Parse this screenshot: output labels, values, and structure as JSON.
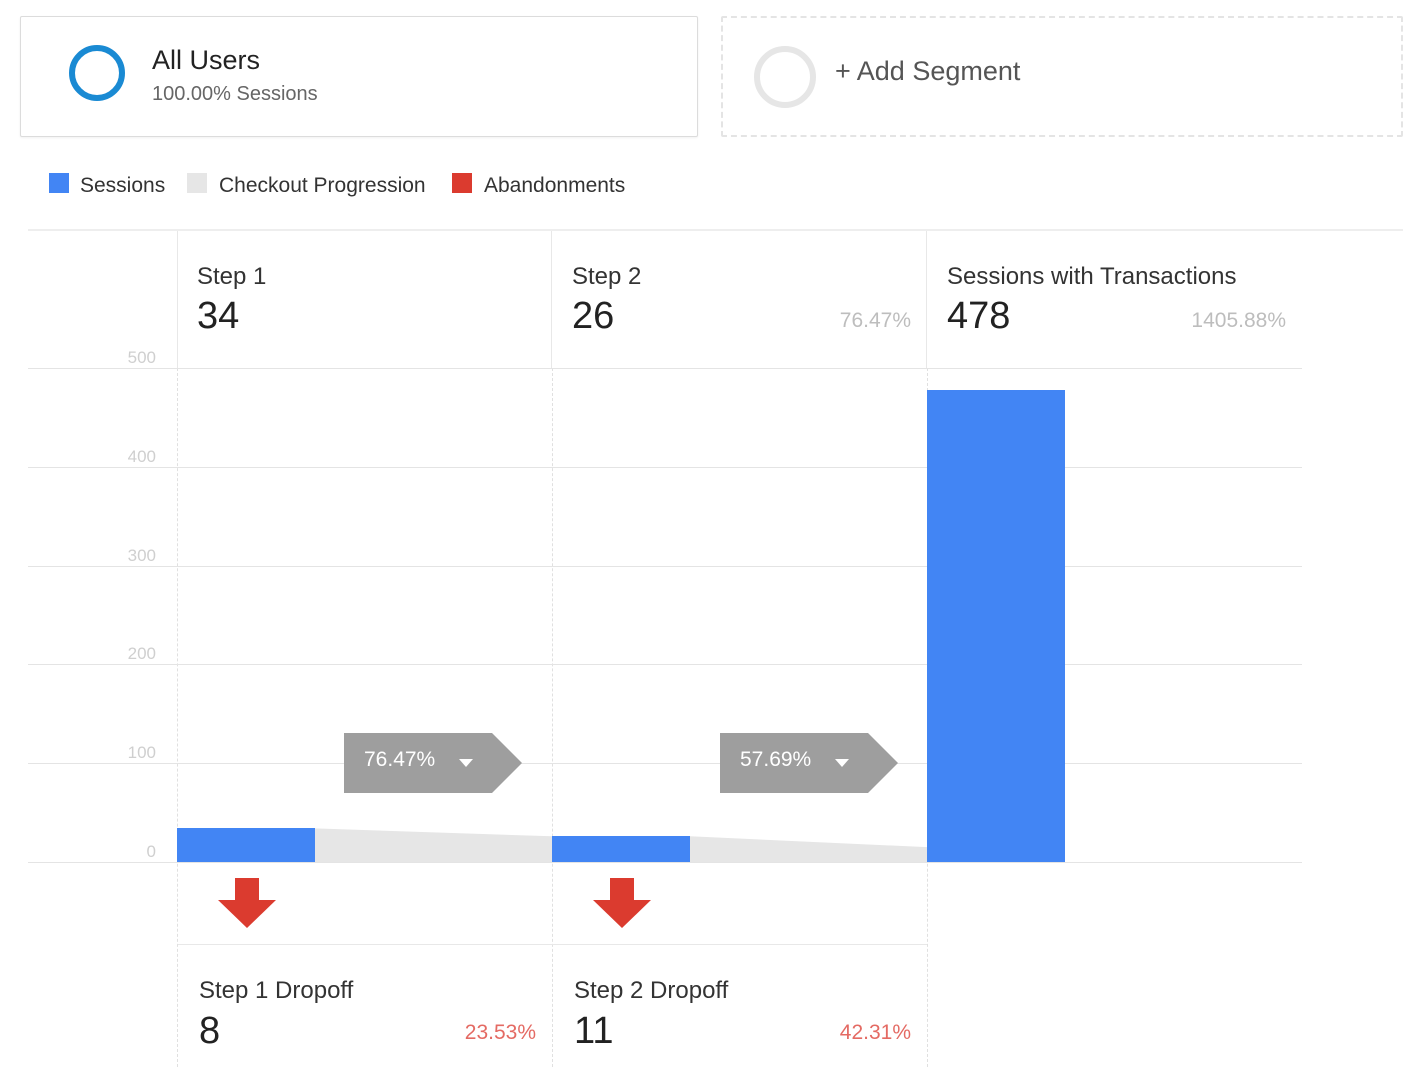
{
  "segments": {
    "active": {
      "title": "All Users",
      "subtitle": "100.00% Sessions",
      "ring_color": "#1a8ad3"
    },
    "add_label": "+ Add Segment"
  },
  "legend": [
    {
      "label": "Sessions",
      "color": "#4285f4"
    },
    {
      "label": "Checkout Progression",
      "color": "#e6e6e6"
    },
    {
      "label": "Abandonments",
      "color": "#db3b2f"
    }
  ],
  "steps": [
    {
      "name": "Step 1",
      "value": "34",
      "pct": ""
    },
    {
      "name": "Step 2",
      "value": "26",
      "pct": "76.47%"
    },
    {
      "name": "Sessions with Transactions",
      "value": "478",
      "pct": "1405.88%"
    }
  ],
  "dropoffs": [
    {
      "name": "Step 1 Dropoff",
      "value": "8",
      "pct": "23.53%"
    },
    {
      "name": "Step 2 Dropoff",
      "value": "11",
      "pct": "42.31%"
    }
  ],
  "progression_tags": [
    "76.47%",
    "57.69%"
  ],
  "chart_data": {
    "type": "bar",
    "categories": [
      "Step 1",
      "Step 2",
      "Sessions with Transactions"
    ],
    "series": [
      {
        "name": "Sessions",
        "values": [
          34,
          26,
          478
        ]
      }
    ],
    "abandonments": [
      8,
      11
    ],
    "checkout_progression_pct": [
      "76.47%",
      "57.69%"
    ],
    "y_ticks": [
      "0",
      "100",
      "200",
      "300",
      "400",
      "500"
    ],
    "ylim": [
      0,
      500
    ],
    "grid": true
  }
}
